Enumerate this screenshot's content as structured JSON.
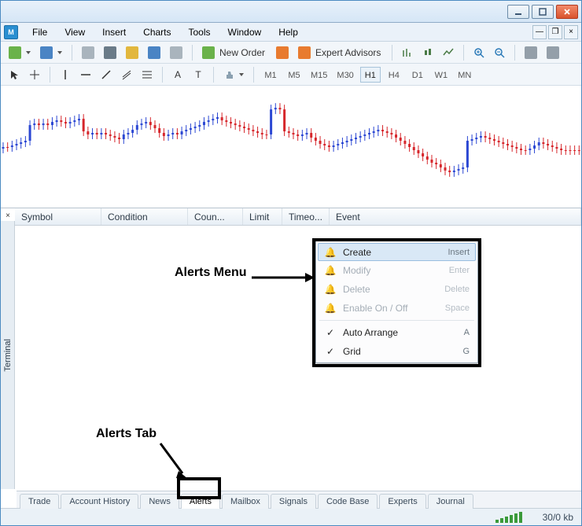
{
  "menus": {
    "file": "File",
    "view": "View",
    "insert": "Insert",
    "charts": "Charts",
    "tools": "Tools",
    "window": "Window",
    "help": "Help"
  },
  "toolbar1": {
    "neworder": "New Order",
    "experts": "Expert Advisors"
  },
  "toolbar2": {
    "a": "A",
    "t": "T"
  },
  "timeframes": {
    "m1": "M1",
    "m5": "M5",
    "m15": "M15",
    "m30": "M30",
    "h1": "H1",
    "h4": "H4",
    "d1": "D1",
    "w1": "W1",
    "mn": "MN"
  },
  "terminal": {
    "label": "Terminal",
    "columns": {
      "symbol": "Symbol",
      "condition": "Condition",
      "count": "Coun...",
      "limit": "Limit",
      "timeout": "Timeo...",
      "event": "Event"
    },
    "tabs": {
      "trade": "Trade",
      "history": "Account History",
      "news": "News",
      "alerts": "Alerts",
      "mailbox": "Mailbox",
      "signals": "Signals",
      "codebase": "Code Base",
      "experts": "Experts",
      "journal": "Journal"
    }
  },
  "contextmenu": {
    "create": "Create",
    "create_sc": "Insert",
    "modify": "Modify",
    "modify_sc": "Enter",
    "delete": "Delete",
    "delete_sc": "Delete",
    "enable": "Enable On / Off",
    "enable_sc": "Space",
    "auto": "Auto Arrange",
    "auto_sc": "A",
    "grid": "Grid",
    "grid_sc": "G"
  },
  "status": {
    "kb": "30/0 kb"
  },
  "annotations": {
    "menu": "Alerts Menu",
    "tab": "Alerts Tab"
  }
}
